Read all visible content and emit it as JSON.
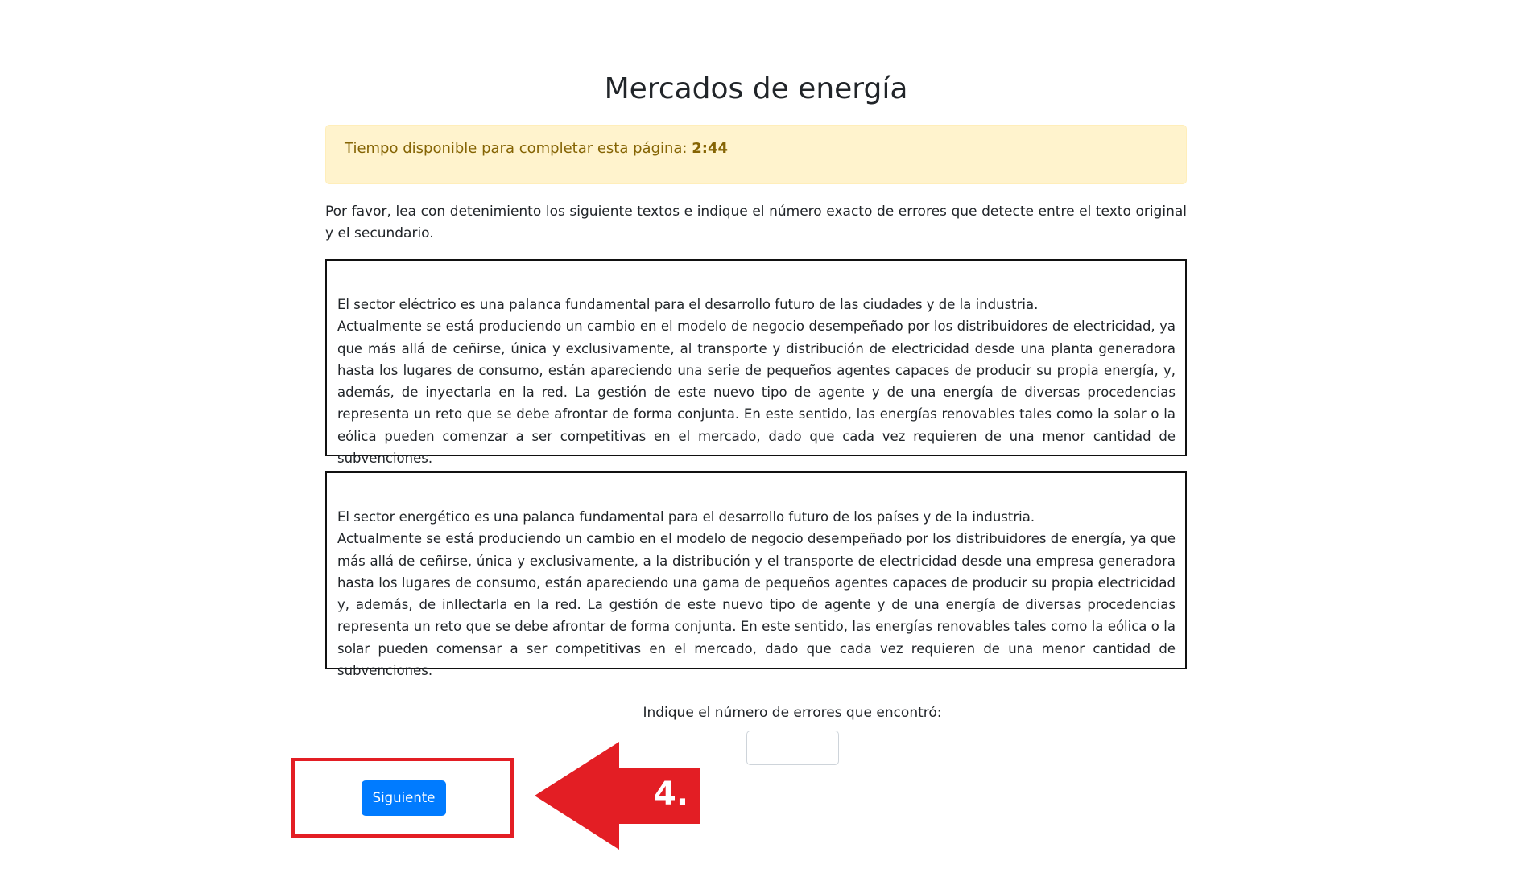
{
  "page": {
    "title": "Mercados de energía"
  },
  "timer": {
    "label": "Tiempo disponible para completar esta página:",
    "value": "2:44"
  },
  "instructions": "Por favor, lea con detenimiento los siguiente textos e indique el número exacto de errores que detecte entre el texto original y el secundario.",
  "texts": {
    "original": {
      "line1": "El sector eléctrico es una palanca fundamental para el desarrollo futuro de las ciudades y de la industria.",
      "line2": "Actualmente se está produciendo un cambio en el modelo de negocio desempeñado por los distribuidores de electricidad, ya que más allá de ceñirse, única y exclusivamente, al transporte y distribución de electricidad desde una planta generadora hasta los lugares de consumo, están apareciendo una serie de pequeños agentes capaces de producir su propia energía, y, además, de inyectarla en la red. La gestión de este nuevo tipo de agente y de una energía de diversas procedencias representa un reto que se debe afrontar de forma conjunta. En este sentido, las energías renovables tales como la solar o la eólica pueden comenzar a ser competitivas en el mercado, dado que cada vez requieren de una menor cantidad de subvenciones."
    },
    "secondary": {
      "line1": "El sector energético es una palanca fundamental para el desarrollo futuro de los países y de la industria.",
      "line2": "Actualmente se está produciendo un cambio en el modelo de negocio desempeñado por los distribuidores de energía, ya que más allá de ceñirse, única y exclusivamente, a la distribución y el transporte de electricidad desde una empresa generadora hasta los lugares de consumo, están apareciendo una gama de pequeños agentes capaces de producir su propia electricidad y, además, de inllectarla en la red. La gestión de este nuevo tipo de agente y de una energía de diversas procedencias representa un reto que se debe afrontar de forma conjunta. En este sentido, las energías renovables tales como la eólica o la solar pueden comensar a ser competitivas en el mercado, dado que cada vez requieren de una menor cantidad de subvenciones."
    }
  },
  "error_count": {
    "label": "Indique el número de errores que encontró:",
    "value": "",
    "placeholder": ""
  },
  "next_button": {
    "label": "Siguiente"
  },
  "annotation": {
    "step": "4.",
    "color": "#e31e24"
  },
  "colors": {
    "primary": "#007bff",
    "alert_background": "#fff3cd",
    "alert_text": "#856404",
    "annotation_red": "#e31e24"
  }
}
